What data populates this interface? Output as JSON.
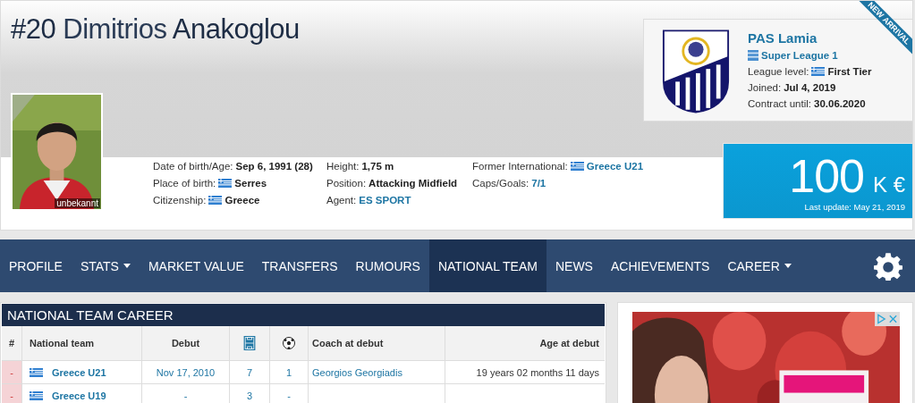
{
  "header": {
    "number": "#20",
    "first_name": "Dimitrios",
    "last_name": "Anakoglou",
    "photo_caption": "unbekannt",
    "ribbon": "NEW ARRIVAL"
  },
  "info": [
    [
      {
        "label": "Date of birth/Age:",
        "value": "Sep 6, 1991 (28)",
        "kind": "text",
        "flag": false
      },
      {
        "label": "Place of birth:",
        "value": "Serres",
        "kind": "text",
        "flag": true
      },
      {
        "label": "Citizenship:",
        "value": "Greece",
        "kind": "text",
        "flag": true
      }
    ],
    [
      {
        "label": "Height:",
        "value": "1,75 m",
        "kind": "text",
        "flag": false
      },
      {
        "label": "Position:",
        "value": "Attacking Midfield",
        "kind": "text",
        "flag": false
      },
      {
        "label": "Agent:",
        "value": "ES SPORT",
        "kind": "link",
        "flag": false
      }
    ],
    [
      {
        "label": "Former International:",
        "value": "Greece U21",
        "kind": "link",
        "flag": true
      },
      {
        "label": "Caps/Goals:",
        "value": "7/1",
        "kind": "link",
        "flag": false
      }
    ]
  ],
  "club": {
    "name": "PAS Lamia",
    "league": "Super League 1",
    "details": [
      {
        "label": "League level:",
        "value": "First Tier",
        "flag": true
      },
      {
        "label": "Joined:",
        "value": "Jul 4, 2019",
        "flag": false
      },
      {
        "label": "Contract until:",
        "value": "30.06.2020",
        "flag": false
      }
    ]
  },
  "market_value": {
    "amount": "100",
    "unit": "K €",
    "updated": "Last update: May 21, 2019"
  },
  "nav": [
    {
      "label": "PROFILE",
      "selected": false,
      "dropdown": false
    },
    {
      "label": "STATS",
      "selected": false,
      "dropdown": true
    },
    {
      "label": "MARKET VALUE",
      "selected": false,
      "dropdown": false
    },
    {
      "label": "TRANSFERS",
      "selected": false,
      "dropdown": false
    },
    {
      "label": "RUMOURS",
      "selected": false,
      "dropdown": false
    },
    {
      "label": "NATIONAL TEAM",
      "selected": true,
      "dropdown": false
    },
    {
      "label": "NEWS",
      "selected": false,
      "dropdown": false
    },
    {
      "label": "ACHIEVEMENTS",
      "selected": false,
      "dropdown": false
    },
    {
      "label": "CAREER",
      "selected": false,
      "dropdown": true
    }
  ],
  "table": {
    "title": "NATIONAL TEAM CAREER",
    "columns": [
      {
        "kind": "text",
        "label": "#"
      },
      {
        "kind": "text",
        "label": "National team"
      },
      {
        "kind": "text",
        "label": "Debut"
      },
      {
        "kind": "pitch"
      },
      {
        "kind": "ball"
      },
      {
        "kind": "text",
        "label": "Coach at debut"
      },
      {
        "kind": "text",
        "label": "Age at debut"
      }
    ],
    "rows": [
      {
        "index": "-",
        "team": "Greece U21",
        "debut": "Nov 17, 2010",
        "caps": "7",
        "goals": "1",
        "coach": "Georgios Georgiadis",
        "age": "19 years 02 months 11 days"
      },
      {
        "index": "-",
        "team": "Greece U19",
        "debut": "-",
        "caps": "3",
        "goals": "-"
      }
    ]
  },
  "ad": {
    "kind": "picture"
  }
}
